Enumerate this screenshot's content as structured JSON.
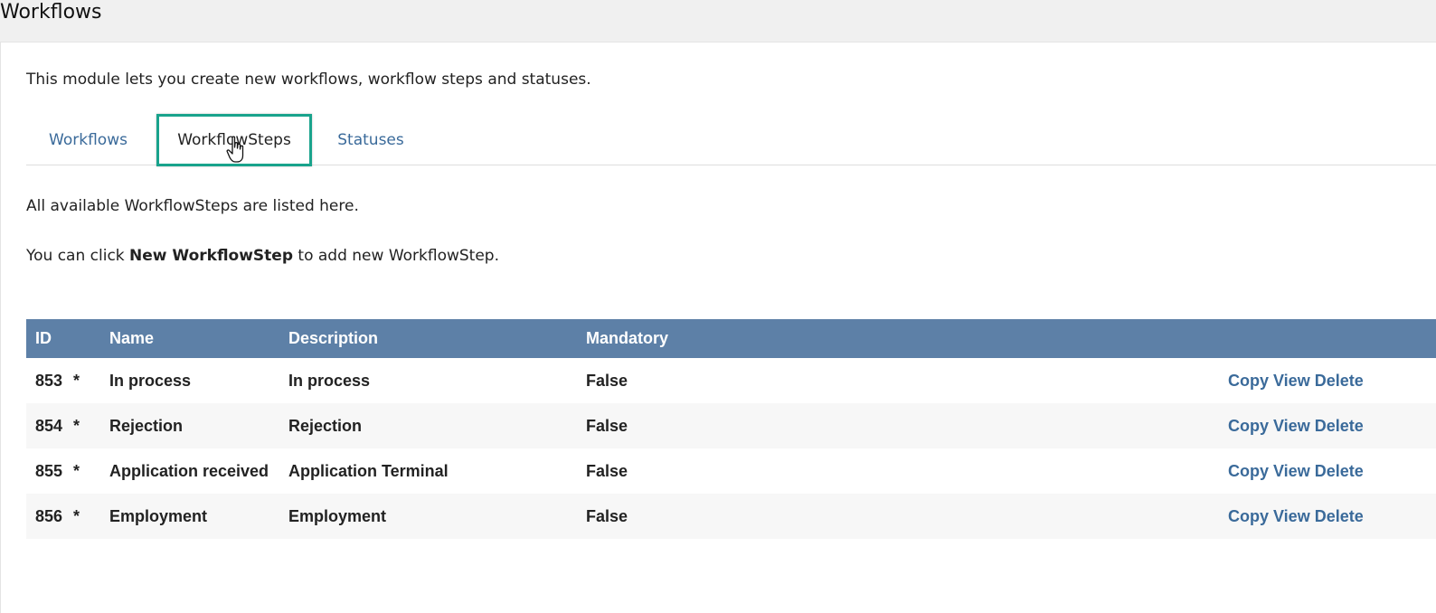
{
  "page": {
    "title": "Workflows",
    "intro": "This module lets you create new workflows, workflow steps and statuses."
  },
  "tabs": [
    {
      "label": "Workflows"
    },
    {
      "label": "WorkflowSteps"
    },
    {
      "label": "Statuses"
    }
  ],
  "content": {
    "line1": "All available WorkflowSteps are listed here.",
    "line2_prefix": "You can click ",
    "line2_bold": "New WorkflowStep",
    "line2_suffix": " to add new WorkflowStep."
  },
  "table": {
    "headers": {
      "id": "ID",
      "name": "Name",
      "description": "Description",
      "mandatory": "Mandatory"
    },
    "rows": [
      {
        "id": "853",
        "star": "*",
        "name": "In process",
        "description": "In process",
        "mandatory": "False"
      },
      {
        "id": "854",
        "star": "*",
        "name": "Rejection",
        "description": "Rejection",
        "mandatory": "False"
      },
      {
        "id": "855",
        "star": "*",
        "name": "Application received",
        "description": "Application Terminal",
        "mandatory": "False"
      },
      {
        "id": "856",
        "star": "*",
        "name": "Employment",
        "description": "Employment",
        "mandatory": "False"
      }
    ],
    "actions": {
      "copy": "Copy",
      "view": "View",
      "delete": "Delete"
    }
  },
  "colors": {
    "header_bg": "#5d80a7",
    "link": "#3a6a9a",
    "active_tab_border": "#19a38c"
  },
  "icons": {
    "cursor": "hand-pointer-icon"
  }
}
